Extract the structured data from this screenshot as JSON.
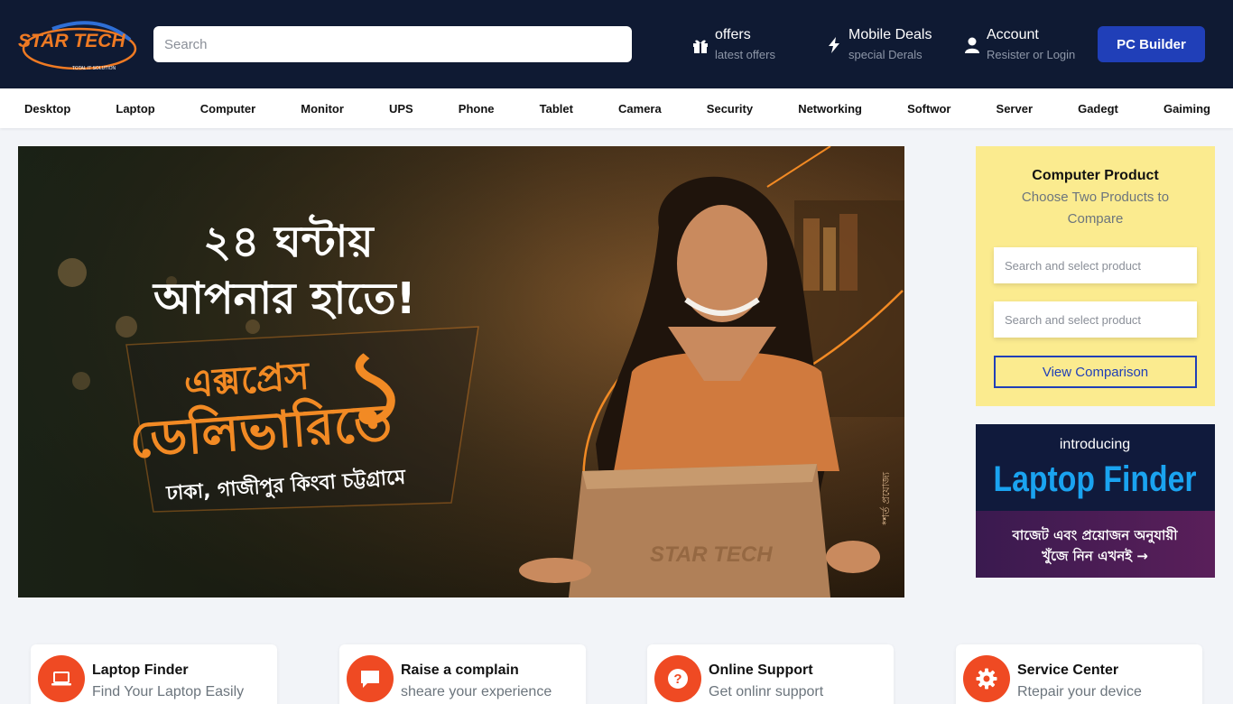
{
  "colors": {
    "header_bg": "#0f1a33",
    "accent_blue": "#203fb8",
    "accent_orange": "#ef4a23",
    "compare_bg": "#fbeb8f"
  },
  "header": {
    "logo_text": "STAR TECH",
    "logo_tagline": "TOTAL IT SOLUTION",
    "search_placeholder": "Search",
    "offers": {
      "icon": "gift-icon",
      "title": "offers",
      "subtitle": "latest offers"
    },
    "mobile_deals": {
      "icon": "lightning-icon",
      "title": "Mobile Deals",
      "subtitle": "special Derals"
    },
    "account": {
      "icon": "user-icon",
      "title": "Account",
      "subtitle": "Resister or Login"
    },
    "pc_builder_label": "PC Builder"
  },
  "nav": {
    "items": [
      "Desktop",
      "Laptop",
      "Computer",
      "Monitor",
      "UPS",
      "Phone",
      "Tablet",
      "Camera",
      "Security",
      "Networking",
      "Softwor",
      "Server",
      "Gadegt",
      "Gaiming"
    ]
  },
  "banner": {
    "line1": "২৪ ঘন্টায়",
    "line2": "আপনার হাতে!",
    "line3": "এক্সপ্রেস",
    "line4": "ডেলিভারিতে",
    "line5": "ঢাকা, গাজীপুর কিংবা চট্টগ্রামে",
    "terms": "*শর্ত প্রযোজ্য",
    "box_logo": "STAR TECH"
  },
  "compare": {
    "title": "Computer Product",
    "subtitle": "Choose Two Products to Compare",
    "input1_placeholder": "Search and select product",
    "input2_placeholder": "Search and select product",
    "button_label": "View Comparison"
  },
  "promo": {
    "intro": "introducing",
    "title": "Laptop Finder",
    "line1": "বাজেট এবং প্রয়োজন অনুযায়ী",
    "line2": "খুঁজে নিন এখনই →"
  },
  "services": [
    {
      "icon": "laptop-icon",
      "title": "Laptop Finder",
      "subtitle": "Find Your Laptop Easily"
    },
    {
      "icon": "chat-icon",
      "title": "Raise a complain",
      "subtitle": "sheare your experience"
    },
    {
      "icon": "question-icon",
      "title": "Online Support",
      "subtitle": "Get onlinr support"
    },
    {
      "icon": "gear-icon",
      "title": "Service Center",
      "subtitle": "Rtepair your device"
    }
  ]
}
